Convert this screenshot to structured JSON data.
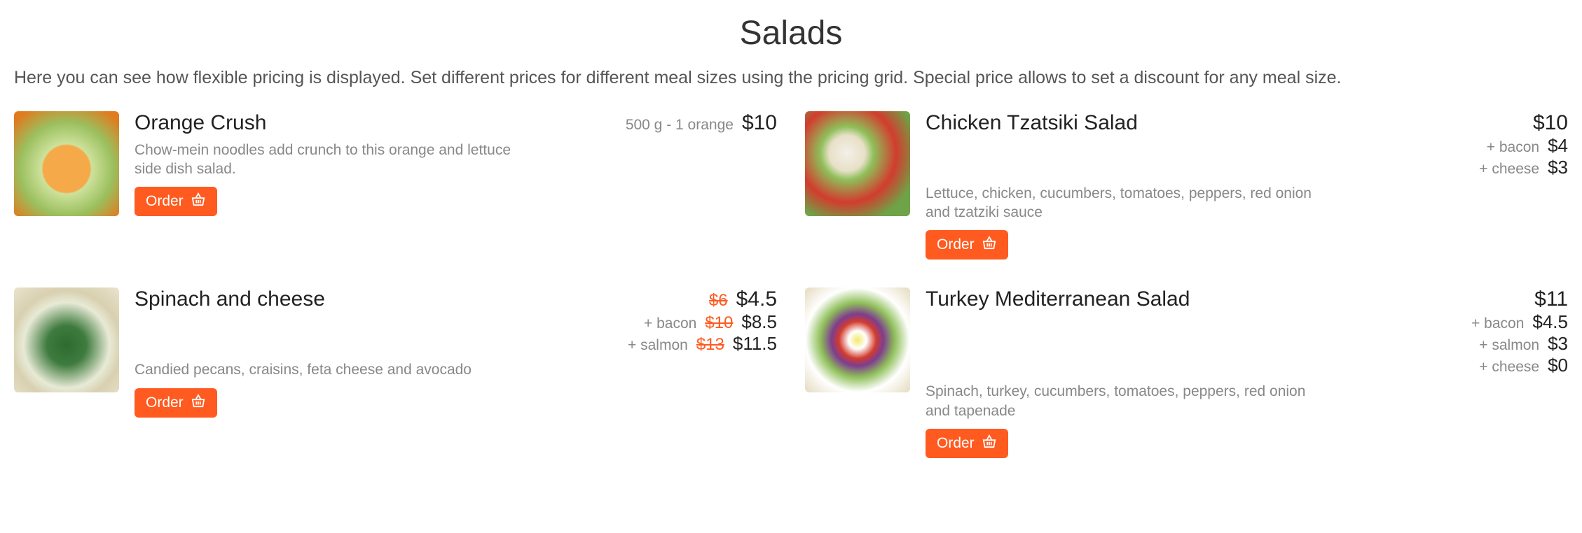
{
  "title": "Salads",
  "intro": "Here you can see how flexible pricing is displayed. Set different prices for different meal sizes using the pricing grid. Special price allows to set a discount for any meal size.",
  "order_label": "Order",
  "items": [
    {
      "name": "Orange Crush",
      "desc": "Chow-mein noodles add crunch to this orange and lettuce side dish salad.",
      "photo_class": "p0",
      "main": {
        "note": "500 g - 1 orange",
        "price": "$10"
      },
      "addons": []
    },
    {
      "name": "Chicken Tzatsiki Salad",
      "desc": "Lettuce, chicken, cucumbers, tomatoes, peppers, red onion and tzatziki sauce",
      "photo_class": "p1",
      "main": {
        "price": "$10"
      },
      "addons": [
        {
          "note": "+ bacon",
          "price": "$4"
        },
        {
          "note": "+ cheese",
          "price": "$3"
        }
      ]
    },
    {
      "name": "Spinach and cheese",
      "desc": "Candied pecans, craisins, feta cheese and avocado",
      "photo_class": "p2",
      "main": {
        "strike": "$6",
        "price": "$4.5"
      },
      "addons": [
        {
          "note": "+ bacon",
          "strike": "$10",
          "price": "$8.5"
        },
        {
          "note": "+ salmon",
          "strike": "$13",
          "price": "$11.5"
        }
      ]
    },
    {
      "name": "Turkey Mediterranean Salad",
      "desc": "Spinach, turkey, cucumbers, tomatoes, peppers, red onion and tapenade",
      "photo_class": "p3",
      "main": {
        "price": "$11"
      },
      "addons": [
        {
          "note": "+ bacon",
          "price": "$4.5"
        },
        {
          "note": "+ salmon",
          "price": "$3"
        },
        {
          "note": "+ cheese",
          "price": "$0"
        }
      ]
    }
  ]
}
